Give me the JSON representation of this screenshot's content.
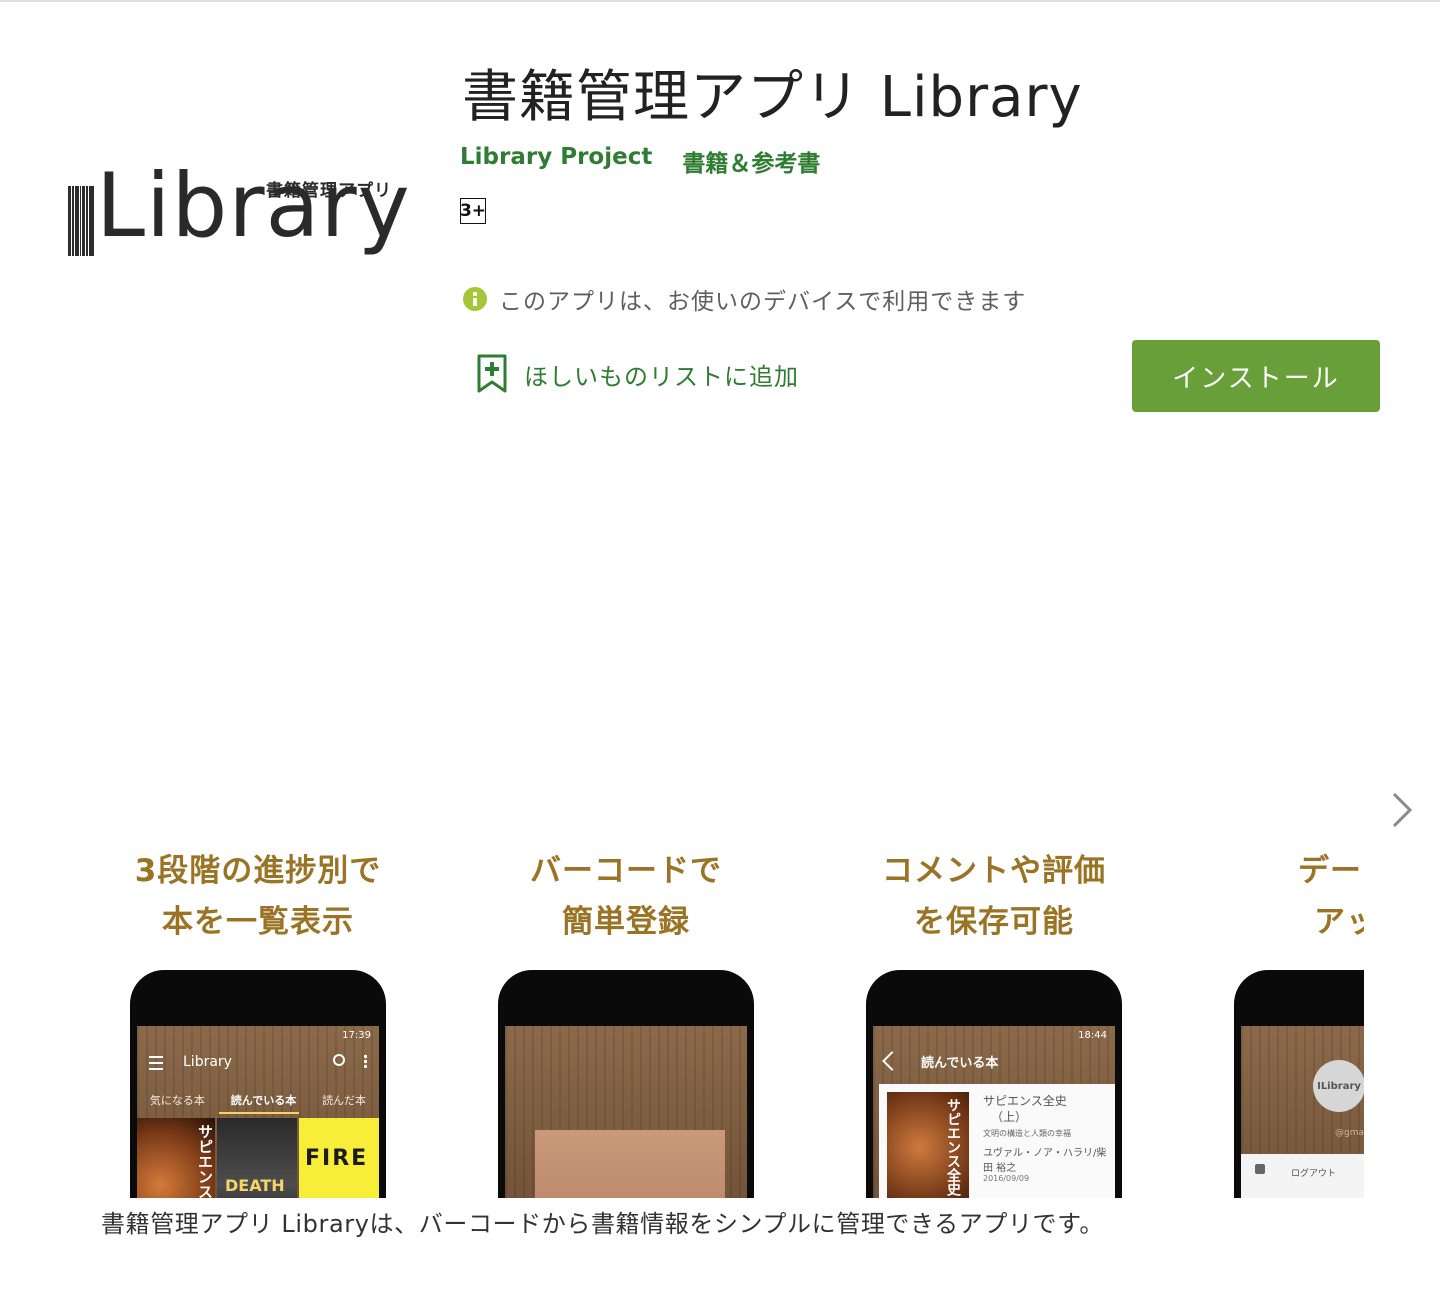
{
  "app": {
    "title": "書籍管理アプリ Library",
    "developer": "Library Project",
    "category": "書籍＆参考書",
    "content_rating": "3+",
    "availability": "このアプリは、お使いのデバイスで利用できます",
    "wishlist_label": "ほしいものリストに追加",
    "install_label": "インストール",
    "description": "書籍管理アプリ Libraryは、バーコードから書籍情報をシンプルに管理できるアプリです。"
  },
  "logo": {
    "subtitle": "書籍管理アプリ",
    "wordmark": "Library"
  },
  "icons": {
    "info": "info-icon",
    "wishlist": "bookmark-add-icon",
    "next": "chevron-right-icon"
  },
  "colors": {
    "accent_green": "#689f38",
    "link_green": "#2f7d32",
    "caption_gold": "#9a7424",
    "info_green": "#a4c639"
  },
  "screenshots": [
    {
      "caption_line1": "3段階の進捗別で",
      "caption_line2": "本を一覧表示",
      "screen": {
        "time": "17:39",
        "app_title": "Library",
        "tabs": [
          "気になる本",
          "読んでいる本",
          "読んだ本"
        ],
        "covers": [
          "サピエンス",
          "DEATH",
          "FIRE"
        ]
      }
    },
    {
      "caption_line1": "バーコードで",
      "caption_line2": "簡単登録"
    },
    {
      "caption_line1": "コメントや評価",
      "caption_line2": "を保存可能",
      "screen": {
        "time": "18:44",
        "screen_title": "読んでいる本",
        "cover": "サピエンス全史",
        "book_title": "サピエンス全史",
        "book_title_2": "（上）",
        "book_subtitle": "文明の構造と人類の幸福",
        "book_author": "ユヴァル・ノア・ハラリ/柴田 裕之",
        "book_date": "2016/09/09"
      }
    },
    {
      "caption_line1": "データの",
      "caption_line2": "アップ",
      "screen": {
        "avatar_text": "ILibrary",
        "email": "@gmail",
        "menu_item": "ログアウト"
      }
    }
  ]
}
